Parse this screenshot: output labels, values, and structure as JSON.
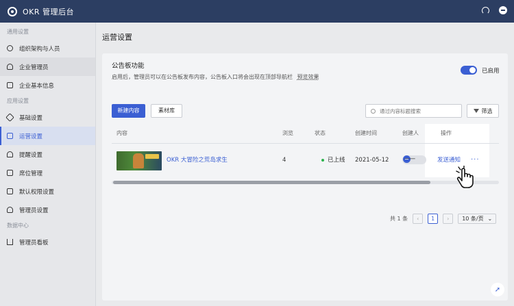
{
  "topbar": {
    "app_title": "OKR 管理后台",
    "icons": [
      "logo-icon",
      "headset-icon",
      "avatar-icon"
    ]
  },
  "sidebar": {
    "groups": [
      {
        "label": "通用设置",
        "items": [
          {
            "label": "组织架构与人员",
            "icon": "org-chart-icon"
          },
          {
            "label": "企业管理员",
            "icon": "user-icon"
          },
          {
            "label": "企业基本信息",
            "icon": "id-card-icon"
          }
        ]
      },
      {
        "label": "应用设置",
        "items": [
          {
            "label": "基础设置",
            "icon": "wrench-icon"
          },
          {
            "label": "运营设置",
            "icon": "briefcase-icon"
          },
          {
            "label": "提醒设置",
            "icon": "bell-icon"
          },
          {
            "label": "席位管理",
            "icon": "seat-icon"
          },
          {
            "label": "默认权限设置",
            "icon": "lock-icon"
          },
          {
            "label": "管理员设置",
            "icon": "user-icon"
          }
        ]
      },
      {
        "label": "数据中心",
        "items": [
          {
            "label": "管理员看板",
            "icon": "bar-chart-icon"
          }
        ]
      }
    ]
  },
  "main": {
    "page_title": "运营设置",
    "bulletin": {
      "title": "公告板功能",
      "description": "启用后，管理员可以在公告板发布内容，公告板入口将会出现在顶部导航栏",
      "preview_link": "预览效果",
      "toggle_label": "已启用",
      "enabled": true
    },
    "toolbar": {
      "new_button": "新建内容",
      "library_button": "素材库",
      "search_placeholder": "通过内容标题搜索",
      "filter_button": "筛选"
    },
    "table": {
      "columns": [
        "内容",
        "浏览",
        "状态",
        "创建时间",
        "创建人",
        "操作"
      ],
      "rows": [
        {
          "title": "OKR 大冒险之荒岛求生",
          "views": "4",
          "status": "已上线",
          "created": "2021-05-12",
          "creator": "一一",
          "action": "发送通知",
          "more": "···"
        }
      ]
    },
    "pagination": {
      "total": "共 1 条",
      "current_page": "1",
      "page_size": "10 条/页"
    }
  },
  "colors": {
    "topbar": "#2c3e62",
    "primary": "#3b5fd3",
    "status_online": "#2bb24c"
  }
}
